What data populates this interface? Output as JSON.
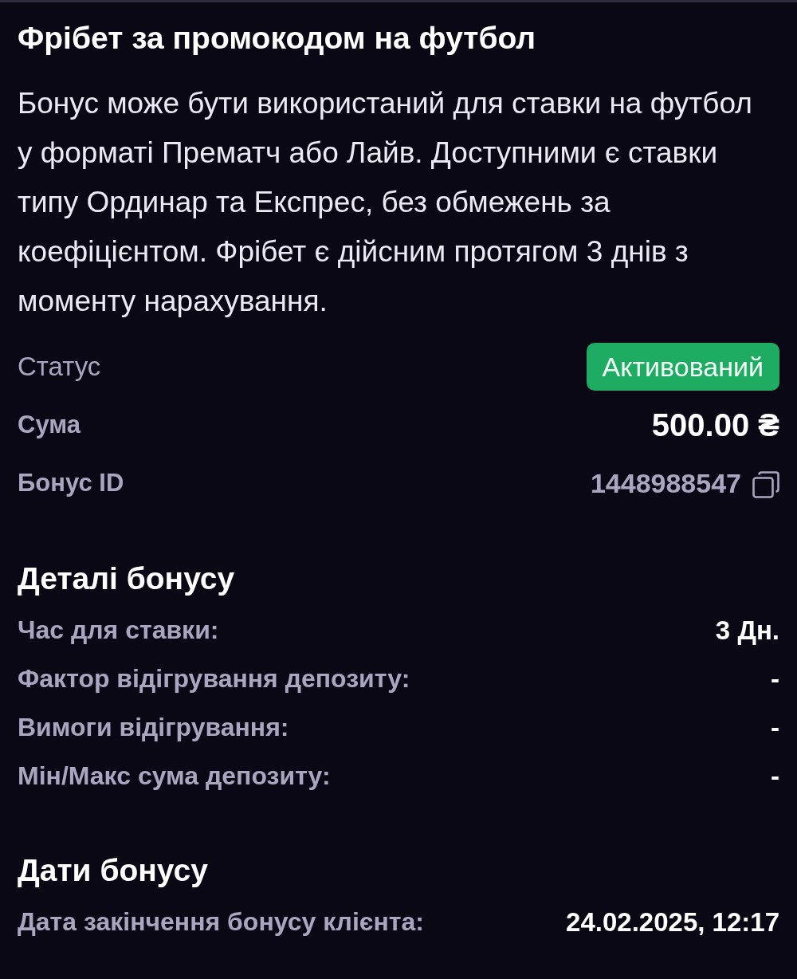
{
  "title": "Фрібет за промокодом на футбол",
  "description": "Бонус може бути використаний для ставки на футбол у форматі Прематч або Лайв. Доступними є ставки типу Ординар та Експрес, без обмежень за коефіцієнтом. Фрібет є дійсним протягом 3 днів з моменту нарахування.",
  "summary": [
    {
      "kind": "status",
      "label": "Статус",
      "value": "Активований"
    },
    {
      "kind": "amount",
      "label": "Сума",
      "value": "500.00 ₴"
    },
    {
      "kind": "id",
      "label": "Бонус ID",
      "value": "1448988547"
    }
  ],
  "sections": [
    {
      "heading": "Деталі бонусу",
      "rows": [
        {
          "label": "Час для ставки:",
          "value": "3 Дн."
        },
        {
          "label": "Фактор відігрування депозиту:",
          "value": "-"
        },
        {
          "label": "Вимоги відігрування:",
          "value": "-"
        },
        {
          "label": "Мін/Макс сума депозиту:",
          "value": "-"
        }
      ]
    },
    {
      "heading": "Дати бонусу",
      "rows": [
        {
          "label": "Дата закінчення бонусу клієнта:",
          "value": "24.02.2025, 12:17"
        }
      ]
    }
  ]
}
